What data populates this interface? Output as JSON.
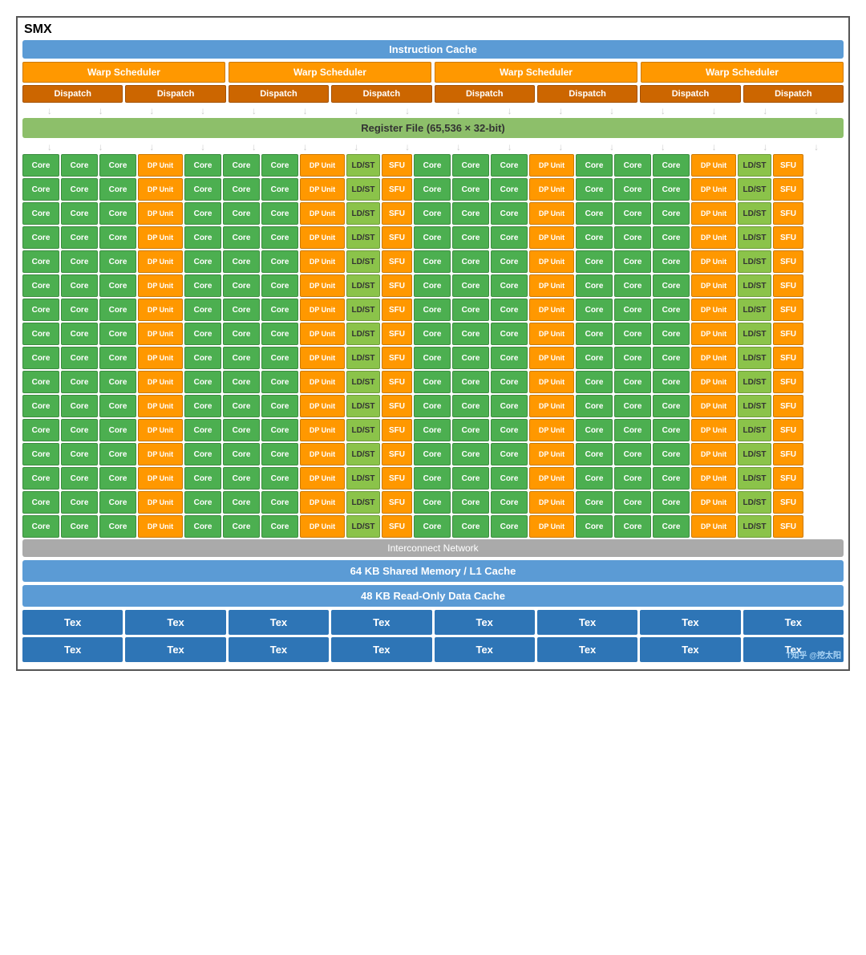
{
  "title": "SMX",
  "instruction_cache": "Instruction Cache",
  "warp_schedulers": [
    "Warp Scheduler",
    "Warp Scheduler",
    "Warp Scheduler",
    "Warp Scheduler"
  ],
  "dispatches": [
    "Dispatch",
    "Dispatch",
    "Dispatch",
    "Dispatch",
    "Dispatch",
    "Dispatch",
    "Dispatch",
    "Dispatch"
  ],
  "register_file": "Register File (65,536 × 32-bit)",
  "core_rows": 16,
  "row_pattern": [
    "Core",
    "Core",
    "Core",
    "DP Unit",
    "Core",
    "Core",
    "Core",
    "DP Unit",
    "LD/ST",
    "SFU",
    "Core",
    "Core",
    "Core",
    "DP Unit",
    "Core",
    "Core",
    "Core",
    "DP Unit",
    "LD/ST",
    "SFU"
  ],
  "interconnect": "Interconnect Network",
  "shared_memory": "64 KB Shared Memory / L1 Cache",
  "readonly_cache": "48 KB Read-Only Data Cache",
  "tex_rows": [
    [
      "Tex",
      "Tex",
      "Tex",
      "Tex",
      "Tex",
      "Tex",
      "Tex",
      "Tex"
    ],
    [
      "Tex",
      "Tex",
      "Tex",
      "Tex",
      "Tex",
      "Tex",
      "Tex",
      "Tex"
    ]
  ],
  "watermark": "T知乎 @挖太阳"
}
